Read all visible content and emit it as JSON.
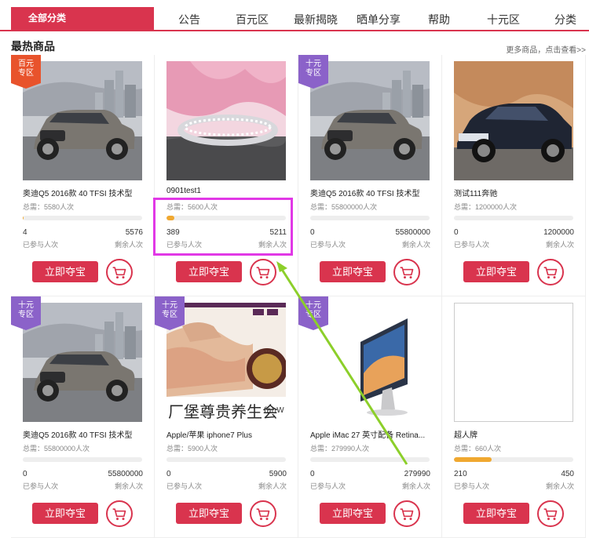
{
  "nav": {
    "all_categories": "全部分类",
    "items": [
      {
        "label": "公告"
      },
      {
        "label": "百元区"
      },
      {
        "label": "最新揭晓"
      },
      {
        "label": "晒单分享"
      },
      {
        "label": "帮助"
      },
      {
        "label": "十元区"
      },
      {
        "label": "分类"
      }
    ]
  },
  "section": {
    "title": "最热商品",
    "more_link": "更多商品，点击查看>>"
  },
  "labels": {
    "joined": "已参与人次",
    "remaining": "剩余人次",
    "buy_button": "立即夺宝"
  },
  "colors": {
    "accent": "#d9344e",
    "badge_red": "#e8532c",
    "badge_purple": "#8b62c9",
    "progress": "#f0a830",
    "annotation_box": "#e138e6",
    "annotation_arrow": "#8ccf2a"
  },
  "products": [
    {
      "badge": "百元专区",
      "badge_top": "百元",
      "badge_bottom": "专区",
      "badge_color": "red",
      "image": "audi-q5-car",
      "name": "奥迪Q5 2016款 40 TFSI 技术型",
      "need": "总需：5580人次",
      "joined": "4",
      "remaining": "5576",
      "progress": 0.001
    },
    {
      "badge": "",
      "badge_top": "",
      "badge_bottom": "",
      "badge_color": "",
      "image": "diamond-ring",
      "name": "0901test1",
      "need": "总需：5600人次",
      "joined": "389",
      "remaining": "5211",
      "progress": 0.069
    },
    {
      "badge": "十元专区",
      "badge_top": "十元",
      "badge_bottom": "专区",
      "badge_color": "purple",
      "image": "audi-q5-car",
      "name": "奥迪Q5 2016款 40 TFSI 技术型",
      "need": "总需：55800000人次",
      "joined": "0",
      "remaining": "55800000",
      "progress": 0
    },
    {
      "badge": "",
      "badge_top": "",
      "badge_bottom": "",
      "badge_color": "",
      "image": "mercedes-sedan",
      "name": "测试111奔驰",
      "need": "总需：1200000人次",
      "joined": "0",
      "remaining": "1200000",
      "progress": 0
    },
    {
      "badge": "十元专区",
      "badge_top": "十元",
      "badge_bottom": "专区",
      "badge_color": "purple",
      "image": "audi-q5-car",
      "name": "奥迪Q5 2016款 40 TFSI 技术型",
      "need": "总需：55800000人次",
      "joined": "0",
      "remaining": "55800000",
      "progress": 0
    },
    {
      "badge": "十元专区",
      "badge_top": "十元",
      "badge_bottom": "专区",
      "badge_color": "purple",
      "image": "spa-massage",
      "name": "Apple/苹果 iphone7 Plus",
      "need": "总需：5900人次",
      "joined": "0",
      "remaining": "5900",
      "progress": 0,
      "image_text": "厂堡尊贵养生会",
      "image_text_small": "fanW"
    },
    {
      "badge": "十元专区",
      "badge_top": "十元",
      "badge_bottom": "专区",
      "badge_color": "purple",
      "image": "imac-computer",
      "name": "Apple iMac 27 英寸配备 Retina...",
      "need": "总需：279990人次",
      "joined": "0",
      "remaining": "279990",
      "progress": 0
    },
    {
      "badge": "",
      "badge_top": "",
      "badge_bottom": "",
      "badge_color": "",
      "image": "blank",
      "name": "超人牌",
      "need": "总需：660人次",
      "joined": "210",
      "remaining": "450",
      "progress": 0.318
    }
  ]
}
